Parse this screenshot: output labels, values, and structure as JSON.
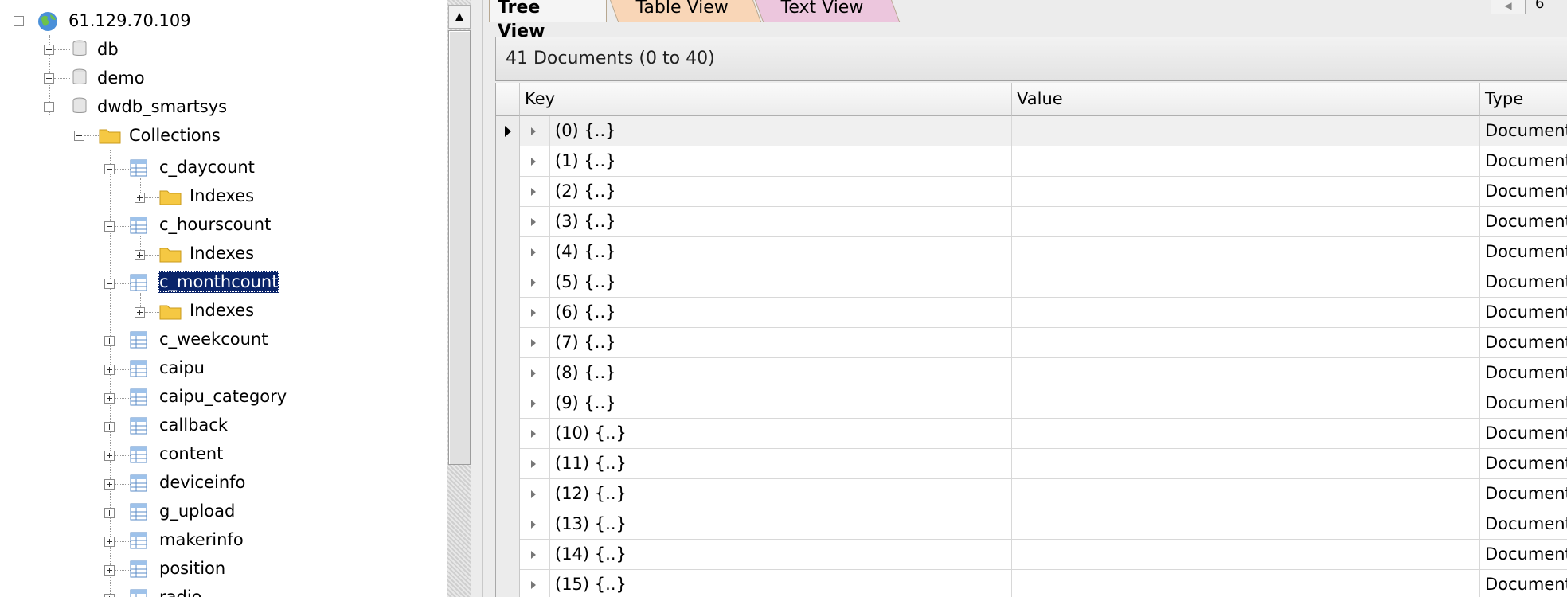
{
  "tree": {
    "server": "61.129.70.109",
    "databases": [
      {
        "name": "db"
      },
      {
        "name": "demo"
      },
      {
        "name": "dwdb_smartsys"
      }
    ],
    "collections_folder": "Collections",
    "indexes_label": "Indexes",
    "collections": [
      "c_daycount",
      "c_hourscount",
      "c_monthcount",
      "c_weekcount",
      "caipu",
      "caipu_category",
      "callback",
      "content",
      "deviceinfo",
      "g_upload",
      "makerinfo",
      "position",
      "radio"
    ],
    "selected": "c_monthcount"
  },
  "tabs": [
    {
      "label": "Tree View",
      "active": true
    },
    {
      "label": "Table View",
      "active": false
    },
    {
      "label": "Text View",
      "active": false
    }
  ],
  "nav": {
    "page_fragment": "6"
  },
  "results": {
    "summary": "41 Documents (0 to 40)",
    "columns": [
      "Key",
      "Value",
      "Type"
    ],
    "rows": [
      {
        "key": "(0) {..}",
        "value": "",
        "type": "Document"
      },
      {
        "key": "(1) {..}",
        "value": "",
        "type": "Document"
      },
      {
        "key": "(2) {..}",
        "value": "",
        "type": "Document"
      },
      {
        "key": "(3) {..}",
        "value": "",
        "type": "Document"
      },
      {
        "key": "(4) {..}",
        "value": "",
        "type": "Document"
      },
      {
        "key": "(5) {..}",
        "value": "",
        "type": "Document"
      },
      {
        "key": "(6) {..}",
        "value": "",
        "type": "Document"
      },
      {
        "key": "(7) {..}",
        "value": "",
        "type": "Document"
      },
      {
        "key": "(8) {..}",
        "value": "",
        "type": "Document"
      },
      {
        "key": "(9) {..}",
        "value": "",
        "type": "Document"
      },
      {
        "key": "(10) {..}",
        "value": "",
        "type": "Document"
      },
      {
        "key": "(11) {..}",
        "value": "",
        "type": "Document"
      },
      {
        "key": "(12) {..}",
        "value": "",
        "type": "Document"
      },
      {
        "key": "(13) {..}",
        "value": "",
        "type": "Document"
      },
      {
        "key": "(14) {..}",
        "value": "",
        "type": "Document"
      },
      {
        "key": "(15) {..}",
        "value": "",
        "type": "Document"
      }
    ]
  },
  "colors": {
    "selection": "#0a246a",
    "tab_table": "#f9d6b7",
    "tab_text": "#ecc6dd"
  }
}
